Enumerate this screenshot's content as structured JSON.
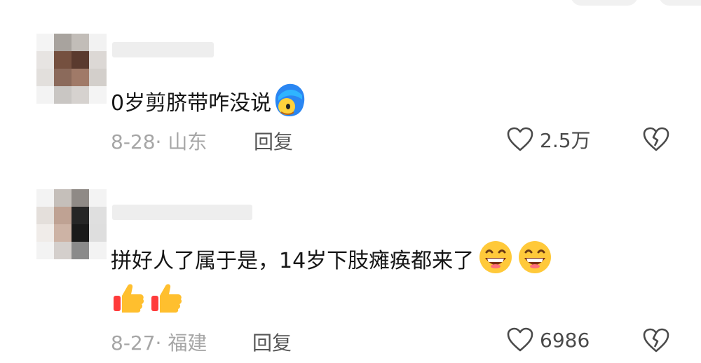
{
  "comments": [
    {
      "text": "0岁剪脐带咋没说",
      "date": "8-28",
      "location": "山东",
      "reply_label": "回复",
      "likes": "2.5万",
      "emojis": [
        "face-emoji"
      ]
    },
    {
      "text": "拼好人了属于是，14岁下肢瘫痪都来了",
      "date": "8-27",
      "location": "福建",
      "reply_label": "回复",
      "likes": "6986",
      "emojis": [
        "grin-emoji",
        "grin-emoji",
        "thumbs-up-emoji",
        "thumbs-up-emoji"
      ]
    }
  ],
  "meta_separator": "·",
  "colors": {
    "text": "#161616",
    "meta": "#a6a6a6",
    "icon": "#4a4a4a"
  }
}
